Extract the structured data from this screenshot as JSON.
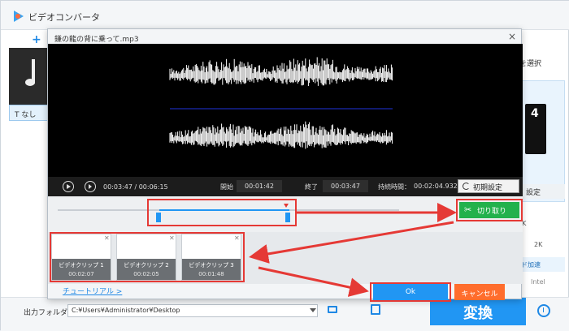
{
  "app": {
    "title": "ビデオコンバータ",
    "add_label": "+"
  },
  "left_panel": {
    "subtitle_label": "T なし"
  },
  "right_panel": {
    "select_label": "を選択",
    "setting_label": "設定",
    "res_label": "4K",
    "res_value": "2K",
    "accel_label": "ド加速",
    "intel_label": "Intel"
  },
  "bottom": {
    "output_label": "出力フォルダ：",
    "output_path": "C:¥Users¥Administrator¥Desktop",
    "convert_label": "変換"
  },
  "dialog": {
    "title": "鎌の龍の背に乗って.mp3",
    "close_label": "×",
    "controls": {
      "current_time": "00:03:47 / 00:06:15",
      "start_label": "開始",
      "start_value": "00:01:42",
      "end_label": "終了",
      "end_value": "00:03:47",
      "duration_label": "持続時間：",
      "duration_value": "00:02:04.932",
      "reset_label": "初期設定"
    },
    "cut_label": "切り取り",
    "selection": {
      "start_fraction": 0.272,
      "end_fraction": 0.605
    },
    "clips": [
      {
        "name": "ビデオクリップ 1",
        "duration": "00:02:07"
      },
      {
        "name": "ビデオクリップ 2",
        "duration": "00:02:05"
      },
      {
        "name": "ビデオクリップ 3",
        "duration": "00:01:48"
      }
    ],
    "tutorial_label": "チュートリアル >",
    "ok_label": "Ok",
    "cancel_label": "キャンセル"
  },
  "colors": {
    "accent": "#2196f3",
    "cut_green": "#22b14c",
    "cancel_orange": "#ff6d2d",
    "annotation_red": "#e53935"
  }
}
